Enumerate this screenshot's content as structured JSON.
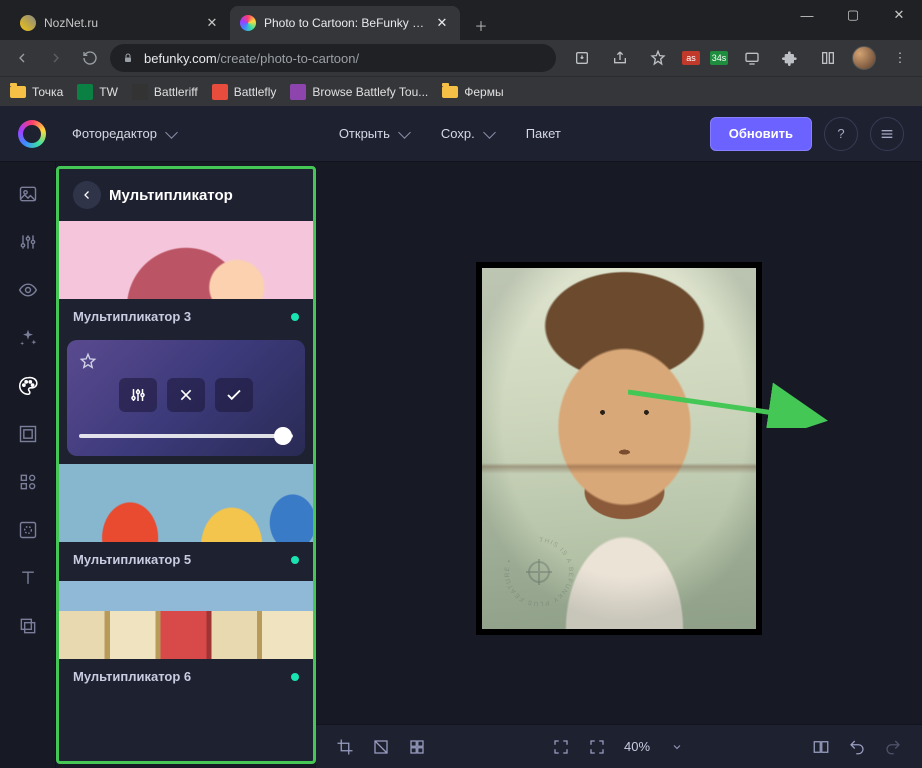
{
  "browser": {
    "tabs": [
      {
        "title": "NozNet.ru",
        "active": false
      },
      {
        "title": "Photo to Cartoon: BeFunky - Cart",
        "active": true
      }
    ],
    "url_host": "befunky.com",
    "url_path": "/create/photo-to-cartoon/",
    "ext_badge": "34s"
  },
  "bookmarks": [
    {
      "label": "Точка",
      "kind": "folder"
    },
    {
      "label": "TW",
      "kind": "sheet"
    },
    {
      "label": "Battleriff",
      "kind": "icon"
    },
    {
      "label": "Battlefly",
      "kind": "icon"
    },
    {
      "label": "Browse Battlefy Tou...",
      "kind": "icon"
    },
    {
      "label": "Фермы",
      "kind": "folder"
    }
  ],
  "header": {
    "editor_dropdown": "Фоторедактор",
    "open": "Открыть",
    "save": "Сохр.",
    "batch": "Пакет",
    "upgrade": "Обновить"
  },
  "panel": {
    "title": "Мультипликатор",
    "presets": [
      {
        "label": "Мультипликатор 3"
      },
      {
        "label": "Мультипликатор 5"
      },
      {
        "label": "Мультипликатор 6"
      }
    ]
  },
  "canvas": {
    "zoom": "40%"
  }
}
